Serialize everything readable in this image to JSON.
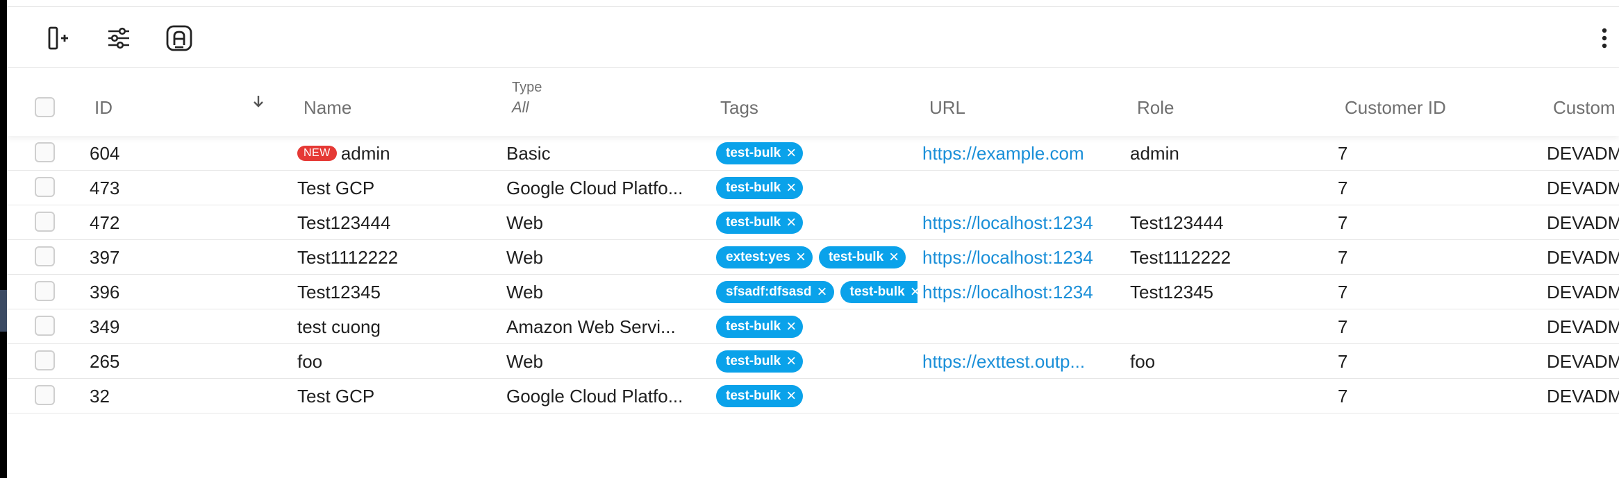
{
  "toolbar": {
    "add_column_icon": "add-column-icon",
    "filter_icon": "sliders-icon",
    "auto_icon": "auto-badge-icon",
    "more_icon": "more-vertical-icon"
  },
  "columns": {
    "id": "ID",
    "name": "Name",
    "type": "Type",
    "type_filter": "All",
    "tags": "Tags",
    "url": "URL",
    "role": "Role",
    "customer_id": "Customer ID",
    "customer_name": "Custom"
  },
  "badge_new": "NEW",
  "rows": [
    {
      "id": "604",
      "name": "admin",
      "is_new": true,
      "type": "Basic",
      "tags": [
        "test-bulk"
      ],
      "url": "https://example.com",
      "role": "admin",
      "customer_id": "7",
      "customer_name": "DEVADM"
    },
    {
      "id": "473",
      "name": "Test GCP",
      "is_new": false,
      "type": "Google Cloud Platfo...",
      "tags": [
        "test-bulk"
      ],
      "url": "",
      "role": "",
      "customer_id": "7",
      "customer_name": "DEVADM"
    },
    {
      "id": "472",
      "name": "Test123444",
      "is_new": false,
      "type": "Web",
      "tags": [
        "test-bulk"
      ],
      "url": "https://localhost:1234",
      "role": "Test123444",
      "customer_id": "7",
      "customer_name": "DEVADM"
    },
    {
      "id": "397",
      "name": "Test1112222",
      "is_new": false,
      "type": "Web",
      "tags": [
        "extest:yes",
        "test-bulk"
      ],
      "url": "https://localhost:1234",
      "role": "Test1112222",
      "customer_id": "7",
      "customer_name": "DEVADM"
    },
    {
      "id": "396",
      "name": "Test12345",
      "is_new": false,
      "type": "Web",
      "tags": [
        "sfsadf:dfsasd",
        "test-bulk"
      ],
      "url": "https://localhost:1234",
      "role": "Test12345",
      "customer_id": "7",
      "customer_name": "DEVADM"
    },
    {
      "id": "349",
      "name": "test cuong",
      "is_new": false,
      "type": "Amazon Web Servi...",
      "tags": [
        "test-bulk"
      ],
      "url": "",
      "role": "",
      "customer_id": "7",
      "customer_name": "DEVADM"
    },
    {
      "id": "265",
      "name": "foo",
      "is_new": false,
      "type": "Web",
      "tags": [
        "test-bulk"
      ],
      "url": "https://exttest.outp...",
      "role": "foo",
      "customer_id": "7",
      "customer_name": "DEVADM"
    },
    {
      "id": "32",
      "name": "Test GCP",
      "is_new": false,
      "type": "Google Cloud Platfo...",
      "tags": [
        "test-bulk"
      ],
      "url": "",
      "role": "",
      "customer_id": "7",
      "customer_name": "DEVADM"
    }
  ],
  "colors": {
    "tag_bg": "#0aa2ea",
    "link": "#1a8fd8",
    "new_badge": "#e53935"
  }
}
